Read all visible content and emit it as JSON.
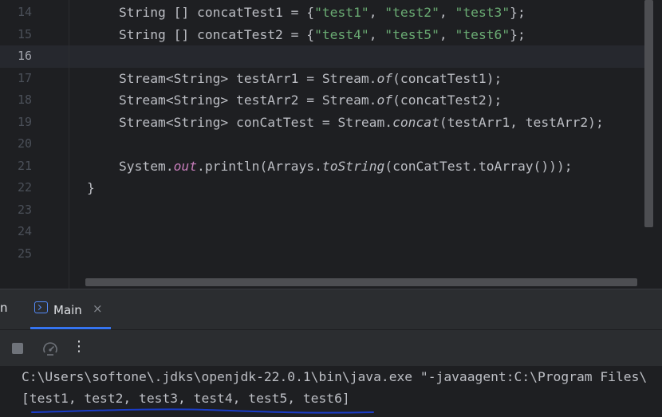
{
  "editor": {
    "line_numbers": [
      "14",
      "15",
      "16",
      "17",
      "18",
      "19",
      "20",
      "21",
      "22",
      "23",
      "24",
      "25"
    ],
    "active_line": "16",
    "code": {
      "l14_a": "String [] concatTest1 = {",
      "l14_s1": "\"test1\"",
      "l14_c1": ", ",
      "l14_s2": "\"test2\"",
      "l14_c2": ", ",
      "l14_s3": "\"test3\"",
      "l14_end": "};",
      "l15_a": "String [] concatTest2 = {",
      "l15_s1": "\"test4\"",
      "l15_c1": ", ",
      "l15_s2": "\"test5\"",
      "l15_c2": ", ",
      "l15_s3": "\"test6\"",
      "l15_end": "};",
      "l17_a": "Stream<String> testArr1 = Stream.",
      "l17_m": "of",
      "l17_b": "(concatTest1);",
      "l18_a": "Stream<String> testArr2 = Stream.",
      "l18_m": "of",
      "l18_b": "(concatTest2);",
      "l19_a": "Stream<String> conCatTest = Stream.",
      "l19_m": "concat",
      "l19_b": "(testArr1, testArr2);",
      "l21_a": "System.",
      "l21_f": "out",
      "l21_b": ".println(Arrays.",
      "l21_m": "toString",
      "l21_c": "(conCatTest.toArray()));",
      "l22": "}"
    }
  },
  "run_panel": {
    "title_fragment": "n",
    "tab_label": "Main",
    "tab_close": "×",
    "toolbar_more": "⋮",
    "console_command": "C:\\Users\\softone\\.jdks\\openjdk-22.0.1\\bin\\java.exe \"-javaagent:C:\\Program Files\\",
    "console_output": "[test1, test2, test3, test4, test5, test6]"
  },
  "colors": {
    "background": "#1e1f22",
    "string": "#6aab73",
    "static_field": "#c77dbb",
    "accent": "#3574f0",
    "annotation_underline": "#1a3cc8"
  }
}
